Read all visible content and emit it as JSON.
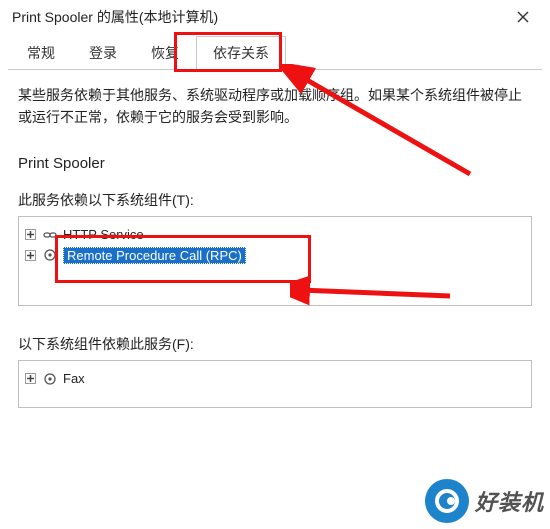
{
  "window": {
    "title": "Print Spooler 的属性(本地计算机)"
  },
  "tabs": {
    "items": [
      "常规",
      "登录",
      "恢复",
      "依存关系"
    ],
    "activeIndex": 3
  },
  "description": "某些服务依赖于其他服务、系统驱动程序或加载顺序组。如果某个系统组件被停止或运行不正常，依赖于它的服务会受到影响。",
  "serviceName": "Print Spooler",
  "dependsOn": {
    "label": "此服务依赖以下系统组件(T):",
    "items": [
      {
        "label": "HTTP Service",
        "iconName": "link-icon",
        "selected": false
      },
      {
        "label": "Remote Procedure Call (RPC)",
        "iconName": "gear-icon",
        "selected": true
      }
    ]
  },
  "dependents": {
    "label": "以下系统组件依赖此服务(F):",
    "items": [
      {
        "label": "Fax",
        "iconName": "gear-icon",
        "selected": false
      }
    ]
  },
  "watermark": "好装机"
}
